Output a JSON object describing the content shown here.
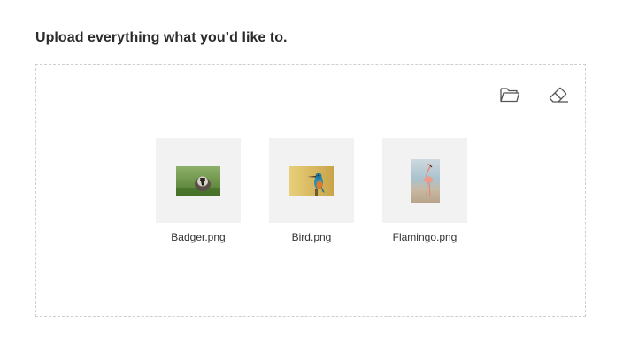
{
  "heading": "Upload everything what you’d like to.",
  "toolbar": {
    "open_icon": "folder-open-icon",
    "clear_icon": "eraser-icon"
  },
  "files": [
    {
      "name": "Badger.png",
      "thumbnail": "badger-photo"
    },
    {
      "name": "Bird.png",
      "thumbnail": "kingfisher-bird-photo"
    },
    {
      "name": "Flamingo.png",
      "thumbnail": "flamingo-photo"
    }
  ],
  "colors": {
    "text": "#2b2b2b",
    "border": "#cfcfcf",
    "thumb_bg": "#f2f2f2",
    "icon": "#555555"
  }
}
